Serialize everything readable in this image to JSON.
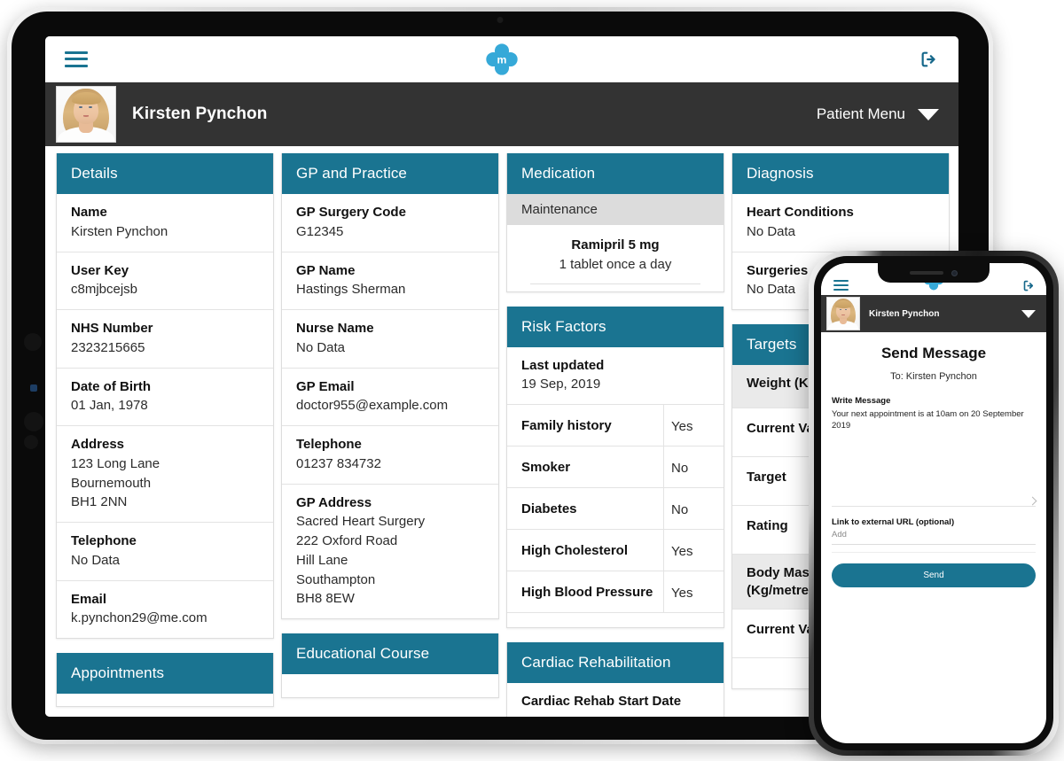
{
  "app": {
    "logo_letter": "m",
    "logo_color": "#36a9d8",
    "accent_color": "#1a7491",
    "dark_bar_color": "#333333",
    "menu_icon": "hamburger-menu-icon",
    "logout_icon": "logout-icon"
  },
  "patient_bar": {
    "name": "Kirsten Pynchon",
    "menu_label": "Patient Menu",
    "caret_icon": "chevron-down-icon",
    "avatar_alt": "Kirsten Pynchon"
  },
  "panels": {
    "details": {
      "title": "Details",
      "rows": [
        {
          "label": "Name",
          "value": [
            "Kirsten Pynchon"
          ]
        },
        {
          "label": "User Key",
          "value": [
            "c8mjbcejsb"
          ]
        },
        {
          "label": "NHS Number",
          "value": [
            "2323215665"
          ]
        },
        {
          "label": "Date of Birth",
          "value": [
            "01 Jan, 1978"
          ]
        },
        {
          "label": "Address",
          "value": [
            "123 Long Lane",
            "Bournemouth",
            "BH1 2NN"
          ]
        },
        {
          "label": "Telephone",
          "value": [
            "No Data"
          ]
        },
        {
          "label": "Email",
          "value": [
            "k.pynchon29@me.com"
          ]
        }
      ]
    },
    "appointments": {
      "title": "Appointments"
    },
    "gp_practice": {
      "title": "GP and Practice",
      "rows": [
        {
          "label": "GP Surgery Code",
          "value": [
            "G12345"
          ]
        },
        {
          "label": "GP Name",
          "value": [
            "Hastings Sherman"
          ]
        },
        {
          "label": "Nurse Name",
          "value": [
            "No Data"
          ]
        },
        {
          "label": "GP Email",
          "value": [
            "doctor955@example.com"
          ]
        },
        {
          "label": "Telephone",
          "value": [
            "01237 834732"
          ]
        },
        {
          "label": "GP Address",
          "value": [
            "Sacred Heart Surgery",
            "222 Oxford Road",
            "Hill Lane",
            "Southampton",
            "BH8 8EW"
          ]
        }
      ]
    },
    "educational_course": {
      "title": "Educational Course"
    },
    "medication": {
      "title": "Medication",
      "subhead": "Maintenance",
      "items": [
        {
          "name": "Ramipril 5 mg",
          "dose": "1 tablet once a day"
        }
      ]
    },
    "risk_factors": {
      "title": "Risk Factors",
      "last_updated_label": "Last updated",
      "last_updated_value": "19 Sep, 2019",
      "rows": [
        {
          "label": "Family history",
          "value": "Yes"
        },
        {
          "label": "Smoker",
          "value": "No"
        },
        {
          "label": "Diabetes",
          "value": "No"
        },
        {
          "label": "High Cholesterol",
          "value": "Yes"
        },
        {
          "label": "High Blood Pressure",
          "value": "Yes"
        }
      ]
    },
    "cardiac_rehabilitation": {
      "title": "Cardiac Rehabilitation",
      "row_label": "Cardiac Rehab Start Date"
    },
    "diagnosis": {
      "title": "Diagnosis",
      "rows": [
        {
          "label": "Heart Conditions",
          "value": "No Data"
        },
        {
          "label": "Surgeries",
          "value": "No Data"
        }
      ]
    },
    "targets": {
      "title": "Targets",
      "groups": [
        {
          "heading": [
            "Weight (Kg)"
          ],
          "rows": [
            "Current Value",
            "Target",
            "Rating"
          ]
        },
        {
          "heading": [
            "Body Mass",
            "(Kg/metre²)"
          ],
          "rows": [
            "Current Value"
          ]
        }
      ]
    }
  },
  "phone": {
    "patient_name": "Kirsten Pynchon",
    "caret_icon": "chevron-down-icon",
    "menu_icon": "hamburger-menu-icon",
    "logout_icon": "logout-icon",
    "title": "Send Message",
    "to_line": "To: Kirsten Pynchon",
    "write_label": "Write Message",
    "message_text": "Your next appointment is at 10am on 20 September 2019",
    "url_label": "Link to external URL (optional)",
    "url_placeholder": "Add",
    "send_label": "Send"
  }
}
